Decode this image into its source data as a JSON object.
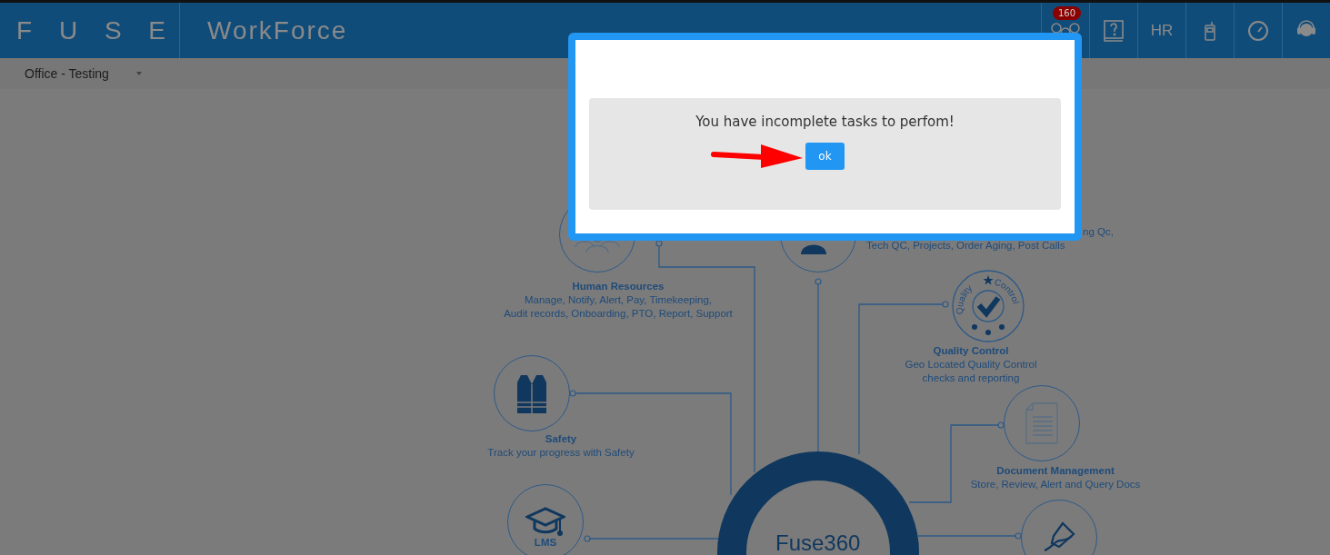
{
  "header": {
    "logo": "F U S E",
    "app_name": "WorkForce",
    "notification_count": "160",
    "hr_label": "HR"
  },
  "office_selector": {
    "value": "Office - Testing"
  },
  "diagram": {
    "modules": [
      {
        "kind": "hr",
        "title": "Human Resources",
        "lines": [
          "Manage, Notify, Alert, Pay, Timekeeping,",
          "Audit records, Onboarding, PTO, Report, Support"
        ]
      },
      {
        "kind": "person",
        "lines": [
          "ng Qc,",
          "Tech QC, Projects, Order Aging, Post Calls"
        ]
      },
      {
        "kind": "quality",
        "badge_text": [
          "Quality",
          "Control"
        ],
        "title": "Quality Control",
        "lines": [
          "Geo Located Quality Control",
          "checks and reporting"
        ]
      },
      {
        "kind": "document",
        "title": "Document Management",
        "lines": [
          "Store, Review, Alert  and Query Docs"
        ]
      },
      {
        "kind": "safety",
        "title": "Safety",
        "lines": [
          "Track your progress with Safety"
        ]
      },
      {
        "kind": "lms",
        "title": "LMS"
      },
      {
        "kind": "signature"
      }
    ],
    "center_label": "Fuse360"
  },
  "dialog": {
    "message": "You have incomplete tasks to perfom!",
    "button": "ok"
  }
}
